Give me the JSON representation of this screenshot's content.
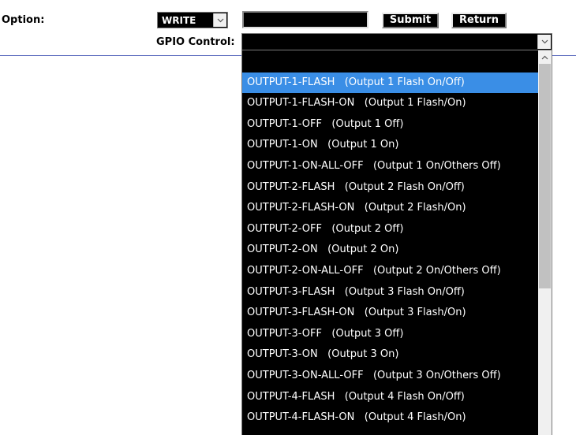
{
  "form": {
    "option_label": "Option:",
    "mode_value": "WRITE",
    "text_value": "",
    "submit_label": "Submit",
    "return_label": "Return",
    "gpio_label": "GPIO Control:",
    "gpio_value": ""
  },
  "dropdown": {
    "selected_index": 1,
    "options": [
      "",
      "OUTPUT-1-FLASH   (Output 1 Flash On/Off)",
      "OUTPUT-1-FLASH-ON   (Output 1 Flash/On)",
      "OUTPUT-1-OFF   (Output 1 Off)",
      "OUTPUT-1-ON   (Output 1 On)",
      "OUTPUT-1-ON-ALL-OFF   (Output 1 On/Others Off)",
      "OUTPUT-2-FLASH   (Output 2 Flash On/Off)",
      "OUTPUT-2-FLASH-ON   (Output 2 Flash/On)",
      "OUTPUT-2-OFF   (Output 2 Off)",
      "OUTPUT-2-ON   (Output 2 On)",
      "OUTPUT-2-ON-ALL-OFF   (Output 2 On/Others Off)",
      "OUTPUT-3-FLASH   (Output 3 Flash On/Off)",
      "OUTPUT-3-FLASH-ON   (Output 3 Flash/On)",
      "OUTPUT-3-OFF   (Output 3 Off)",
      "OUTPUT-3-ON   (Output 3 On)",
      "OUTPUT-3-ON-ALL-OFF   (Output 3 On/Others Off)",
      "OUTPUT-4-FLASH   (Output 4 Flash On/Off)",
      "OUTPUT-4-FLASH-ON   (Output 4 Flash/On)"
    ]
  },
  "colors": {
    "highlight": "#3a8ee6",
    "control_bg": "#000000",
    "divider": "#5f6fbf"
  }
}
